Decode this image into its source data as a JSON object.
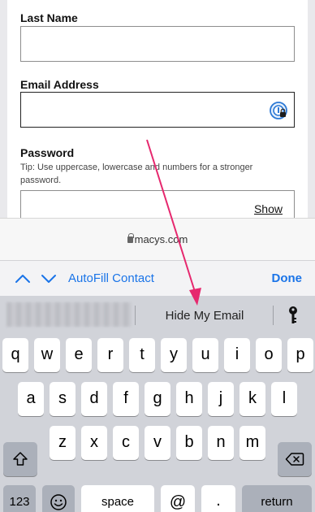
{
  "form": {
    "last_name_label": "Last Name",
    "last_name_value": "",
    "email_label": "Email Address",
    "email_value": "",
    "password_label": "Password",
    "password_tip": "Tip: Use uppercase, lowercase and numbers for a stronger password.",
    "show_label": "Show"
  },
  "browser": {
    "url": "macys.com"
  },
  "toolbar": {
    "autofill_label": "AutoFill Contact",
    "done_label": "Done"
  },
  "suggestions": {
    "hide_my_email": "Hide My Email",
    "key_icon": "key-icon"
  },
  "keyboard": {
    "row1": [
      "q",
      "w",
      "e",
      "r",
      "t",
      "y",
      "u",
      "i",
      "o",
      "p"
    ],
    "row2": [
      "a",
      "s",
      "d",
      "f",
      "g",
      "h",
      "j",
      "k",
      "l"
    ],
    "row3": [
      "z",
      "x",
      "c",
      "v",
      "b",
      "n",
      "m"
    ],
    "numbers_label": "123",
    "space_label": "space",
    "at_label": "@",
    "dot_label": ".",
    "return_label": "return"
  },
  "colors": {
    "accent": "#1a74e8",
    "annotation_arrow": "#e6286e"
  }
}
